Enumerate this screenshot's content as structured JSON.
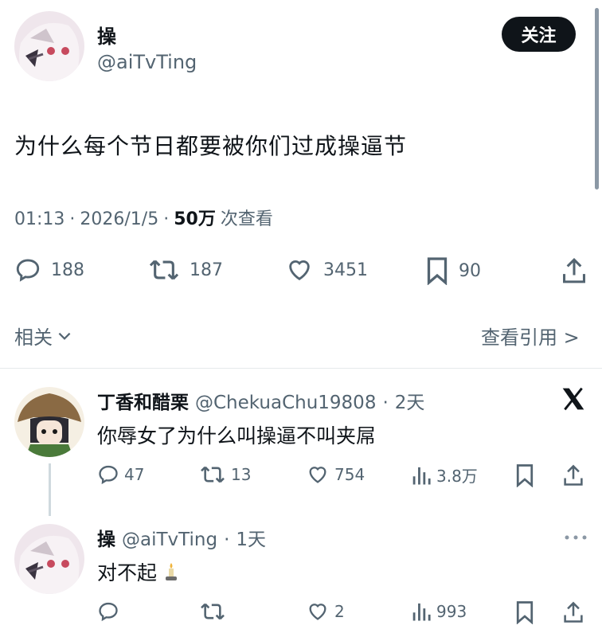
{
  "main_post": {
    "display_name": "操",
    "handle": "@aiTvTing",
    "follow_label": "关注",
    "text": "为什么每个节日都要被你们过成操逼节",
    "time": "01:13",
    "date": "2026/1/5",
    "views_count": "50万",
    "views_label": "次查看",
    "sep": "·",
    "stats": {
      "replies": "188",
      "retweets": "187",
      "likes": "3451",
      "bookmarks": "90"
    }
  },
  "related": {
    "label": "相关",
    "quote_link": "查看引用 >"
  },
  "reply1": {
    "display_name": "丁香和醋栗",
    "handle": "@ChekuaChu19808",
    "time": "2天",
    "text": "你辱女了为什么叫操逼不叫夹屌",
    "stats": {
      "replies": "47",
      "retweets": "13",
      "likes": "754",
      "views": "3.8万"
    }
  },
  "reply2": {
    "display_name": "操",
    "handle": "@aiTvTing",
    "time": "1天",
    "text": "对不起",
    "stats": {
      "replies": "",
      "retweets": "",
      "likes": "2",
      "views": "993"
    }
  },
  "icons": [
    "reply-icon",
    "retweet-icon",
    "like-icon",
    "bookmark-icon",
    "share-icon",
    "views-icon",
    "x-logo-icon",
    "more-icon",
    "chevron-down-icon",
    "candle-emoji"
  ],
  "colors": {
    "text": "#0f1419",
    "muted": "#536471",
    "button_bg": "#0f1419",
    "divider": "#e6e9eb"
  }
}
